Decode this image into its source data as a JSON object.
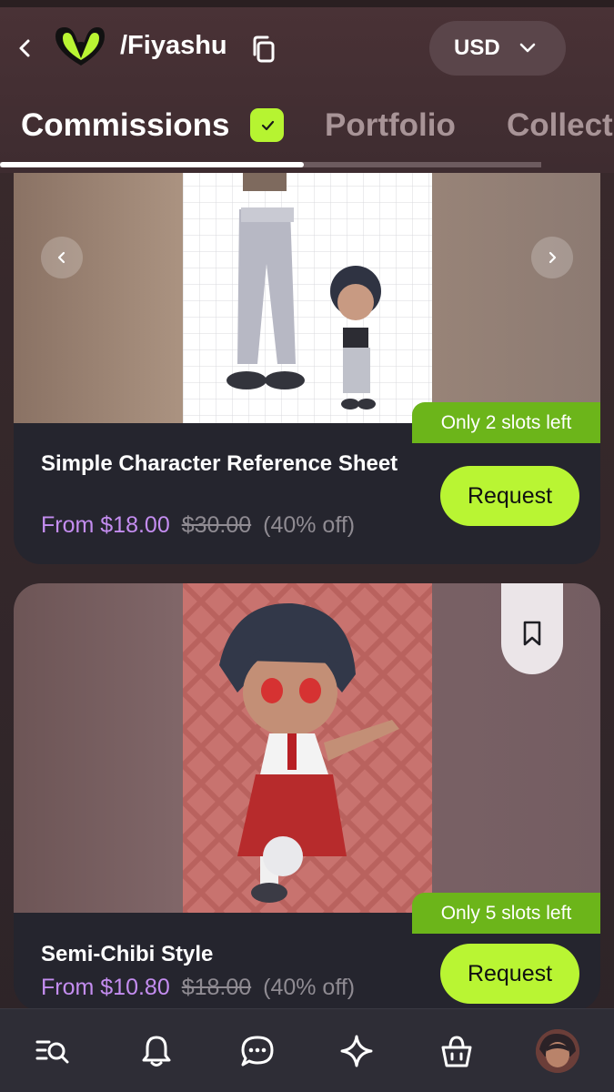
{
  "header": {
    "store_handle": "/Fiyashu",
    "currency": "USD",
    "tabs": [
      {
        "label": "Commissions",
        "active": true,
        "verified": true
      },
      {
        "label": "Portfolio",
        "active": false
      },
      {
        "label": "Collect",
        "active": false
      }
    ]
  },
  "cards": [
    {
      "title": "Simple Character Reference Sheet",
      "price_from": "From $18.00",
      "price_old": "$30.00",
      "discount": "(40% off)",
      "slots": "Only 2 slots left",
      "request_label": "Request",
      "icons": [
        "chevron-left-icon",
        "chevron-right-icon"
      ]
    },
    {
      "title": "Semi-Chibi Style",
      "price_from": "From $10.80",
      "price_old": "$18.00",
      "discount": "(40% off)",
      "slots": "Only 5 slots left",
      "request_label": "Request",
      "icons": [
        "bookmark-icon"
      ]
    }
  ],
  "bottom_nav": {
    "items": [
      "browse-search-icon",
      "bell-icon",
      "chat-icon",
      "sparkle-icon",
      "shopping-bag-icon",
      "avatar"
    ]
  },
  "colors": {
    "accent": "#b9f533",
    "price": "#c48df0",
    "badge": "#6cb51a",
    "card_bg": "#25252e",
    "header_bg": "#4a3236"
  }
}
